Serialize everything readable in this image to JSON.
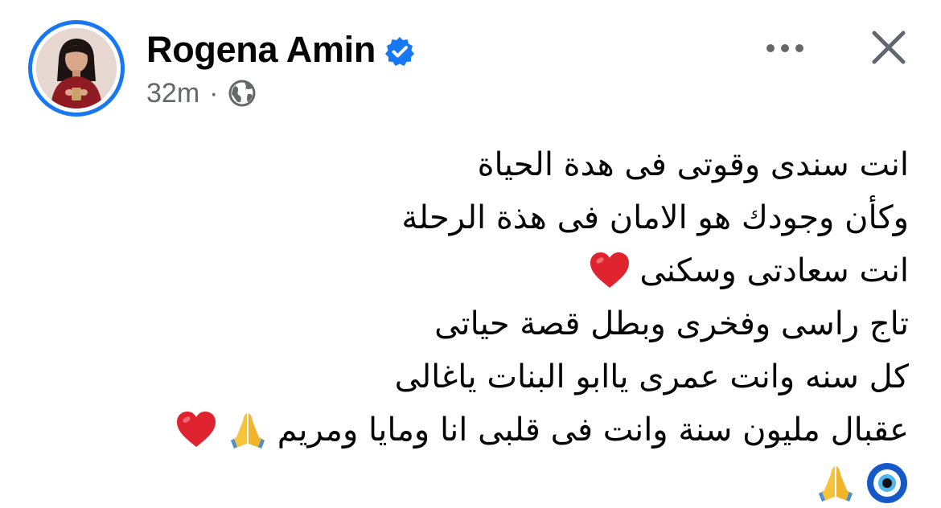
{
  "post": {
    "author": "Rogena Amin",
    "verified": true,
    "time": "32m",
    "separator": "·",
    "audience_icon": "globe-icon",
    "more_icon": "more-dots-icon",
    "close_icon": "close-icon",
    "lines": [
      {
        "text": "انت سندى وقوتى فى هدة الحياة",
        "emojis": []
      },
      {
        "text": "وكأن وجودك هو الامان فى هذة الرحلة",
        "emojis": []
      },
      {
        "text": " انت سعادتى وسكنى",
        "emojis": [
          "red-heart-emoji"
        ]
      },
      {
        "text": "تاج راسى وفخرى وبطل قصة حياتى",
        "emojis": []
      },
      {
        "text": "كل سنه وانت عمرى ياابو البنات ياغالى",
        "emojis": []
      },
      {
        "text": "عقبال مليون سنة وانت فى قلبى انا ومايا ومريم",
        "emojis": [
          "folded-hands-emoji",
          "red-heart-emoji"
        ]
      },
      {
        "text": "",
        "emojis": [
          "nazar-amulet-emoji",
          "folded-hands-emoji"
        ]
      }
    ]
  },
  "colors": {
    "accent": "#1877f2",
    "text": "#050505",
    "secondary_text": "#65676b",
    "heart": "#e0242f"
  }
}
